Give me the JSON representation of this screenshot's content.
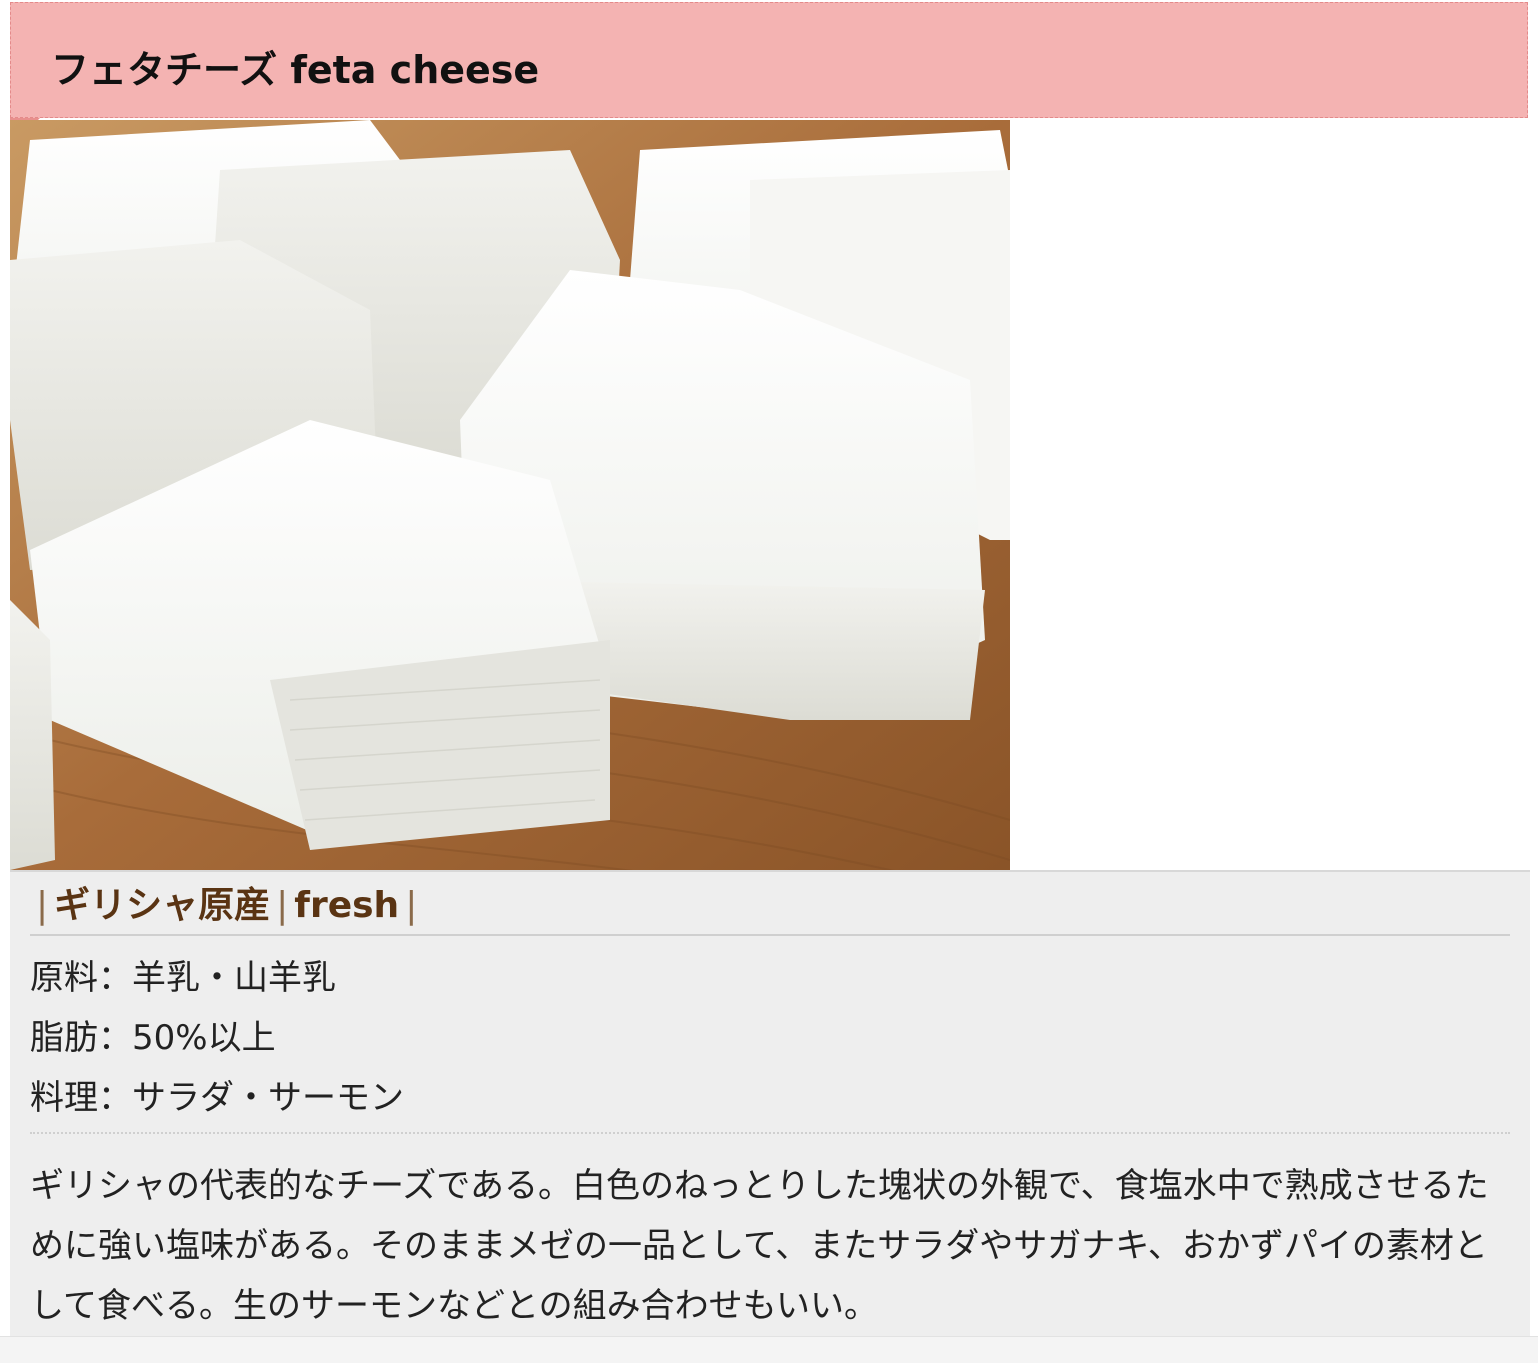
{
  "heading": {
    "title": "フェタチーズ feta cheese"
  },
  "photo": {
    "subject": "feta-cheese-cubes"
  },
  "tags": {
    "origin": "ギリシャ原産",
    "type": "fresh",
    "separator": "|"
  },
  "specs": [
    {
      "label": "原料",
      "value": "羊乳・山羊乳"
    },
    {
      "label": "脂肪",
      "value": "50%以上"
    },
    {
      "label": "料理",
      "value": "サラダ・サーモン"
    }
  ],
  "spec_separator": "：",
  "description": "ギリシャの代表的なチーズである。白色のねっとりした塊状の外観で、食塩水中で熟成させるために強い塩味がある。そのままメゼの一品として、またサラダやサガナキ、おかずパイの素材として食べる。生のサーモンなどとの組み合わせもいい。",
  "colors": {
    "heading_bg": "#f4b3b2",
    "tag_text": "#5a3413",
    "info_bg": "#eeeeee"
  }
}
